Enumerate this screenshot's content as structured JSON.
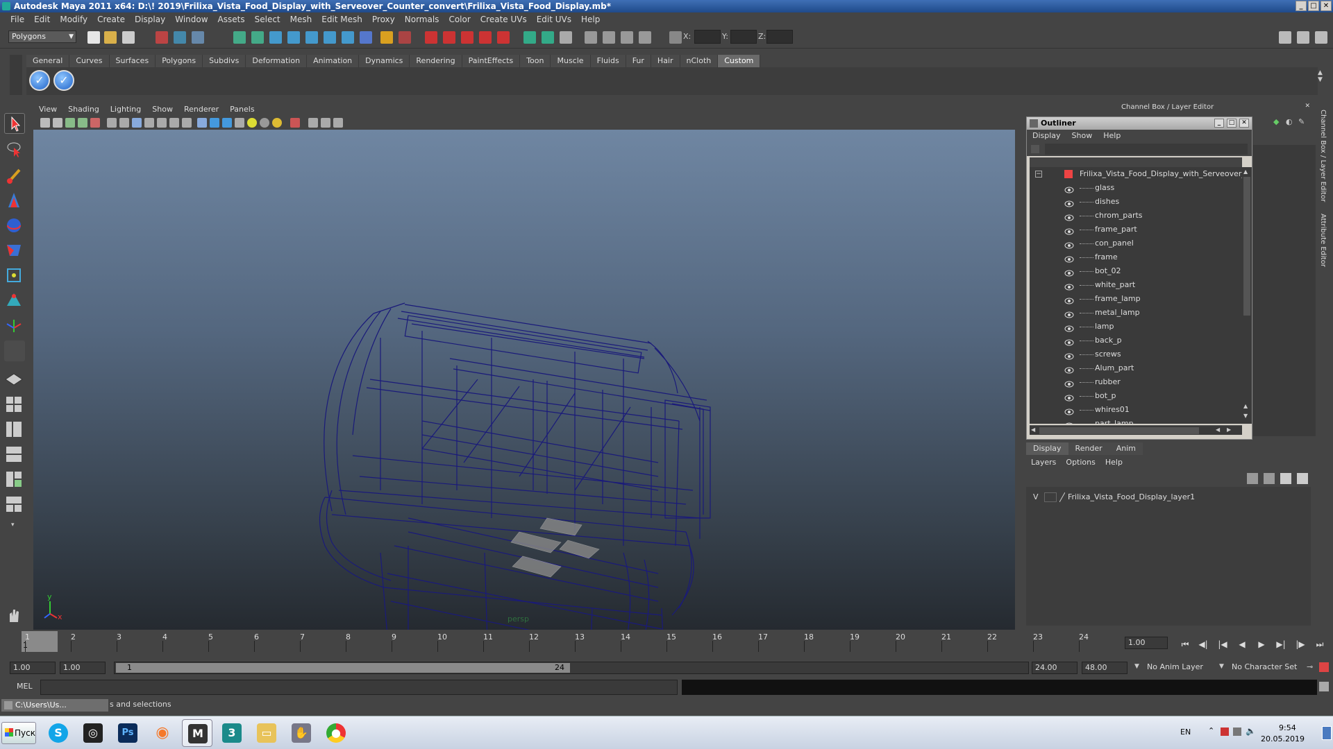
{
  "window": {
    "title": "Autodesk Maya 2011 x64: D:\\! 2019\\Frilixa_Vista_Food_Display_with_Serveover_Counter_convert\\Frilixa_Vista_Food_Display.mb*",
    "min": "_",
    "max": "□",
    "close": "✕"
  },
  "menubar": [
    "File",
    "Edit",
    "Modify",
    "Create",
    "Display",
    "Window",
    "Assets",
    "Select",
    "Mesh",
    "Edit Mesh",
    "Proxy",
    "Normals",
    "Color",
    "Create UVs",
    "Edit UVs",
    "Help"
  ],
  "statusline": {
    "mode": "Polygons",
    "x_label": "X:",
    "y_label": "Y:",
    "z_label": "Z:"
  },
  "shelf": {
    "tabs": [
      "General",
      "Curves",
      "Surfaces",
      "Polygons",
      "Subdivs",
      "Deformation",
      "Animation",
      "Dynamics",
      "Rendering",
      "PaintEffects",
      "Toon",
      "Muscle",
      "Fluids",
      "Fur",
      "Hair",
      "nCloth",
      "Custom"
    ],
    "active_tab": "Custom"
  },
  "viewport": {
    "menu": [
      "View",
      "Shading",
      "Lighting",
      "Show",
      "Renderer",
      "Panels"
    ],
    "camera_label": "persp",
    "axis_y": "y",
    "axis_x": "x"
  },
  "channel_box": {
    "title": "Channel Box / Layer Editor"
  },
  "outliner": {
    "title": "Outliner",
    "menu": [
      "Display",
      "Show",
      "Help"
    ],
    "root": "Frilixa_Vista_Food_Display_with_Serveover_Co",
    "items": [
      "glass",
      "dishes",
      "chrom_parts",
      "frame_part",
      "con_panel",
      "frame",
      "bot_02",
      "white_part",
      "frame_lamp",
      "metal_lamp",
      "lamp",
      "back_p",
      "screws",
      "Alum_part",
      "rubber",
      "bot_p",
      "whires01",
      "part_lamp"
    ]
  },
  "layer_editor": {
    "tabs": [
      "Display",
      "Render",
      "Anim"
    ],
    "active_tab": "Display",
    "menu": [
      "Layers",
      "Options",
      "Help"
    ],
    "layer_visible": "V",
    "layer_name": "Frilixa_Vista_Food_Display_layer1"
  },
  "side_tabs": [
    "Channel Box / Layer Editor",
    "Attribute Editor"
  ],
  "timeline": {
    "ticks": [
      "1",
      "2",
      "3",
      "4",
      "5",
      "6",
      "7",
      "8",
      "9",
      "10",
      "11",
      "12",
      "13",
      "14",
      "15",
      "16",
      "17",
      "18",
      "19",
      "20",
      "21",
      "22",
      "23",
      "24"
    ],
    "current_frame": "1",
    "frame_field": "1.00"
  },
  "range": {
    "start": "1.00",
    "playback_start": "1.00",
    "slider_start": "1",
    "slider_end": "24",
    "playback_end": "24.00",
    "end": "48.00",
    "anim_layer": "No Anim Layer",
    "char_set": "No Character Set"
  },
  "cmdline": {
    "label": "MEL"
  },
  "helpline": {
    "window_title": "C:\\Users\\Us...",
    "text": "s and selections"
  },
  "taskbar": {
    "start": "Пуск",
    "lang": "EN",
    "time": "9:54",
    "date": "20.05.2019"
  },
  "colors": {
    "wire": "#1a1a7a",
    "accent": "#3a6fb5"
  }
}
